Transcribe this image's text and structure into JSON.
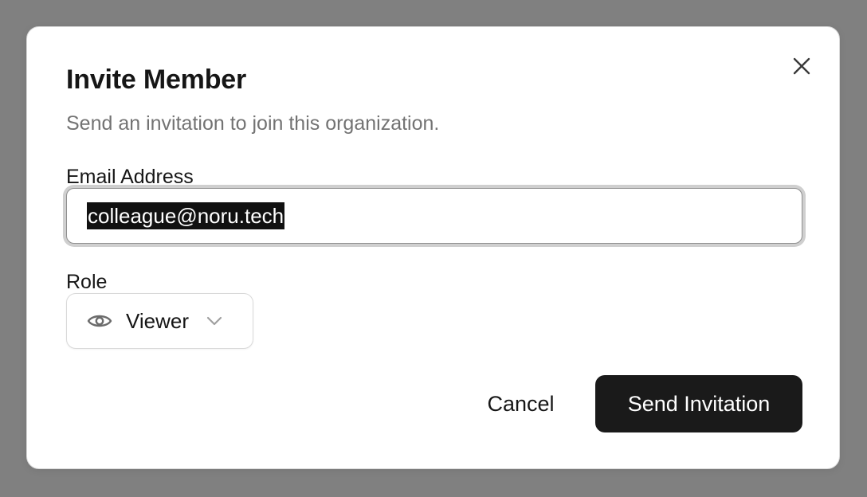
{
  "dialog": {
    "title": "Invite Member",
    "subtitle": "Send an invitation to join this organization.",
    "close_icon": "close-icon"
  },
  "email": {
    "label": "Email Address",
    "value": "colleague@noru.tech"
  },
  "role": {
    "label": "Role",
    "value": "Viewer",
    "icon": "eye-icon",
    "dropdown_icon": "chevron-down-icon"
  },
  "actions": {
    "cancel_label": "Cancel",
    "submit_label": "Send Invitation"
  },
  "colors": {
    "backdrop": "#808080",
    "primary_button": "#1a1a1a",
    "muted_text": "#737373",
    "text": "#161616"
  }
}
